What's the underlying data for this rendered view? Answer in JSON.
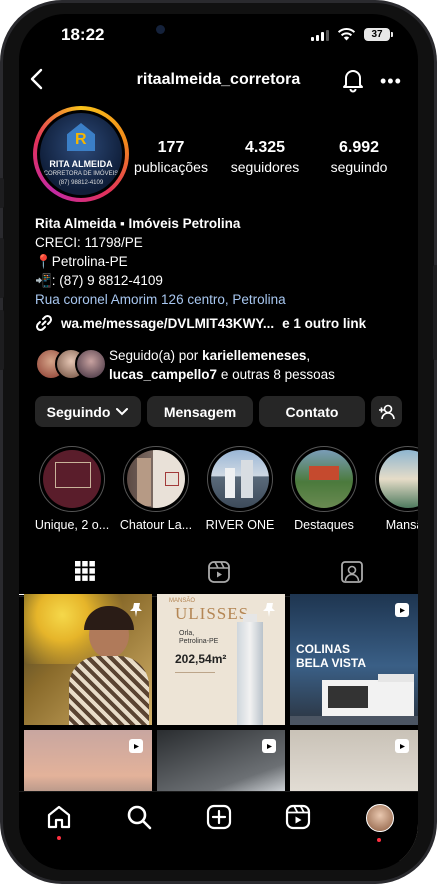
{
  "status": {
    "time": "18:22",
    "battery": "37"
  },
  "header": {
    "username": "ritaalmeida_corretora"
  },
  "avatar": {
    "line1": "RITA ALMEIDA",
    "line2": "CORRETORA DE IMÓVEIS",
    "line3": "(87) 98812-4109"
  },
  "stats": [
    {
      "value": "177",
      "label": "publicações"
    },
    {
      "value": "4.325",
      "label": "seguidores"
    },
    {
      "value": "6.992",
      "label": "seguindo"
    }
  ],
  "bio": {
    "name": "Rita Almeida ▪ Imóveis Petrolina",
    "creci": "CRECI: 11798/PE",
    "location": "📍Petrolina-PE",
    "phone": "📲: (87) 9 8812-4109",
    "address": "Rua coronel Amorim 126 centro, Petrolina"
  },
  "links": {
    "main": "wa.me/message/DVLMIT43KWY...",
    "more": "e 1 outro link"
  },
  "followed_by": {
    "prefix": "Seguido(a) por ",
    "user1": "kariellemeneses",
    "sep": ",",
    "user2": "lucas_campello7",
    "suffix": " e outras 8 pessoas"
  },
  "buttons": {
    "following": "Seguindo",
    "message": "Mensagem",
    "contact": "Contato"
  },
  "highlights": [
    {
      "label": "Unique, 2 o..."
    },
    {
      "label": "Chatour La..."
    },
    {
      "label": "RIVER ONE"
    },
    {
      "label": "Destaques"
    },
    {
      "label": "Mansão"
    }
  ],
  "posts": {
    "ulisses_brand": "MANSÃO",
    "ulisses_title": "ULISSES",
    "ulisses_loc1": "Orla,",
    "ulisses_loc2": "Petrolina-PE",
    "ulisses_area": "202,54m²",
    "colinas_title1": "COLINAS",
    "colinas_title2": "BELA VISTA"
  },
  "colors": {
    "background": "#000000",
    "link": "#a8c7f0",
    "button": "#262626",
    "notification": "#ff3040"
  }
}
